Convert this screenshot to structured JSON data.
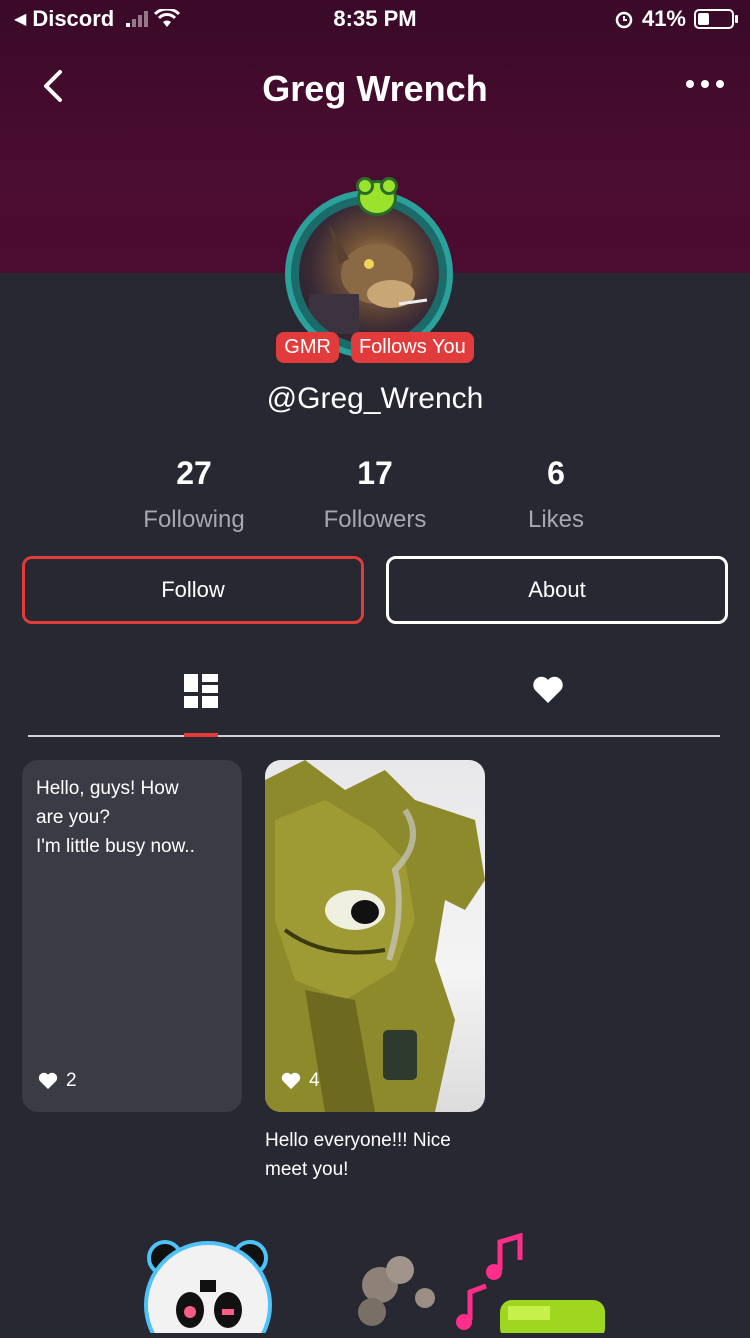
{
  "status_bar": {
    "back_app": "Discord",
    "time": "8:35 PM",
    "battery": "41%",
    "battery_level": 0.41
  },
  "nav": {
    "title": "Greg Wrench"
  },
  "profile": {
    "badges": [
      "GMR",
      "Follows You"
    ],
    "handle": "@Greg_Wrench"
  },
  "stats": [
    {
      "value": "27",
      "label": "Following"
    },
    {
      "value": "17",
      "label": "Followers"
    },
    {
      "value": "6",
      "label": "Likes"
    }
  ],
  "actions": {
    "follow": "Follow",
    "about": "About"
  },
  "tabs": [
    {
      "icon": "posts-grid-icon",
      "active": true
    },
    {
      "icon": "heart-icon",
      "active": false
    }
  ],
  "posts": [
    {
      "text": "Hello, guys! How\nare you?\nI'm little busy now..",
      "likes": "2"
    },
    {
      "caption": "Hello everyone!!! Nice\nmeet you!",
      "likes": "4"
    }
  ],
  "colors": {
    "accent": "#e23b3b",
    "background": "#272831",
    "header": "#4a0c30",
    "card": "#3a3b45"
  }
}
